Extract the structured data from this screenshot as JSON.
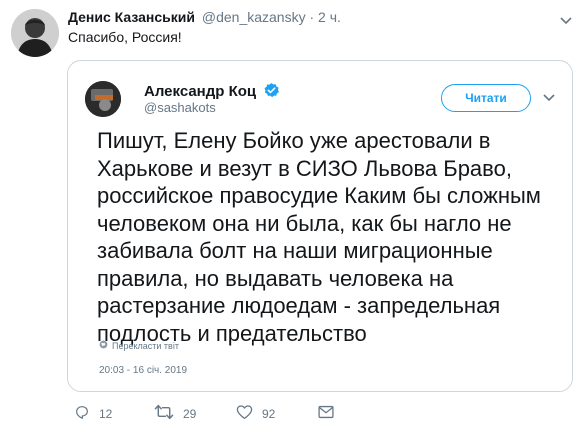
{
  "tweet": {
    "author_name": "Денис Казанський",
    "author_handle": "@den_kazansky",
    "separator": "·",
    "time": "2 ч.",
    "text": "Спасибо, Россия!"
  },
  "quoted": {
    "author_name": "Александр Коц",
    "author_handle": "@sashakots",
    "follow_label": "Читати",
    "text": "Пишут, Елену Бойко уже арестовали в Харькове и везут в СИЗО Львова Браво, российское правосудие Каким бы сложным человеком она ни была, как бы нагло не забивала болт на наши миграционные правила, но выдавать человека на растерзание людоедам - запредельная подлость и предательство",
    "translate_label": "Перекласти твіт",
    "timestamp": "20:03 - 16 січ. 2019"
  },
  "actions": {
    "replies": "12",
    "retweets": "29",
    "likes": "92"
  },
  "colors": {
    "accent": "#1da1f2",
    "secondary_text": "#657786",
    "border": "#ccd6dd"
  },
  "icons": [
    "caret-down-icon",
    "verified-badge-icon",
    "globe-icon",
    "reply-icon",
    "retweet-icon",
    "like-icon",
    "message-icon"
  ]
}
